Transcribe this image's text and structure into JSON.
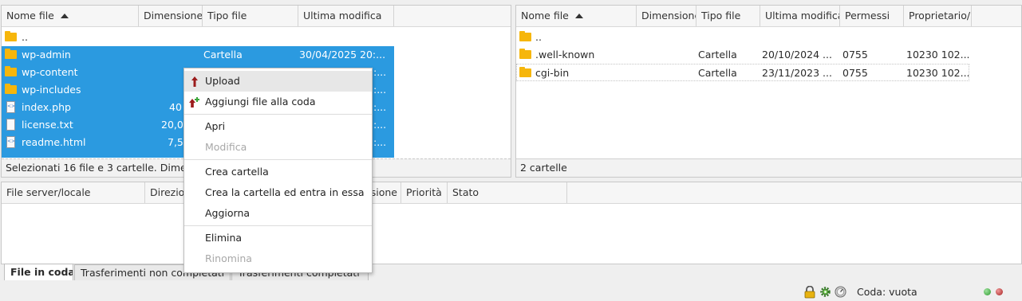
{
  "local_pane": {
    "columns": [
      "Nome file",
      "Dimensione",
      "Tipo file",
      "Ultima modifica"
    ],
    "rows": [
      {
        "name": "..",
        "size": "",
        "type": "",
        "modified": "",
        "icon": "folder-icon",
        "selected": false
      },
      {
        "name": "wp-admin",
        "size": "",
        "type": "Cartella",
        "modified": "30/04/2025 20:...",
        "icon": "folder-icon",
        "selected": true
      },
      {
        "name": "wp-content",
        "size": "",
        "type": "",
        "modified": ":...",
        "icon": "folder-icon",
        "selected": true
      },
      {
        "name": "wp-includes",
        "size": "",
        "type": "",
        "modified": ":...",
        "icon": "folder-icon",
        "selected": true
      },
      {
        "name": "index.php",
        "size": "40",
        "type": "",
        "modified": ":...",
        "icon": "file-code-icon",
        "selected": true
      },
      {
        "name": "license.txt",
        "size": "20,0",
        "type": "",
        "modified": ":...",
        "icon": "file-icon",
        "selected": true
      },
      {
        "name": "readme.html",
        "size": "7,5",
        "type": "",
        "modified": ":...",
        "icon": "file-code-icon",
        "selected": true
      }
    ],
    "status": "Selezionati 16 file e 3 cartelle. Dimensi"
  },
  "remote_pane": {
    "columns": [
      "Nome file",
      "Dimensione",
      "Tipo file",
      "Ultima modifica",
      "Permessi",
      "Proprietario/"
    ],
    "rows": [
      {
        "name": "..",
        "type": "",
        "modified": "",
        "perms": "",
        "owner": ""
      },
      {
        "name": ".well-known",
        "type": "Cartella",
        "modified": "20/10/2024 ...",
        "perms": "0755",
        "owner": "10230 102..."
      },
      {
        "name": "cgi-bin",
        "type": "Cartella",
        "modified": "23/11/2023 ...",
        "perms": "0755",
        "owner": "10230 102..."
      }
    ],
    "status": "2 cartelle"
  },
  "queue": {
    "columns": [
      "File server/locale",
      "Direzio",
      "sione",
      "Priorità",
      "Stato"
    ]
  },
  "context_menu": {
    "items": [
      {
        "label": "Upload",
        "icon": "upload-arrow-icon"
      },
      {
        "label": "Aggiungi file alla coda",
        "icon": "add-to-queue-icon"
      },
      {
        "label": "Apri"
      },
      {
        "label": "Modifica",
        "disabled": true
      },
      {
        "label": "Crea cartella"
      },
      {
        "label": "Crea la cartella ed entra in essa"
      },
      {
        "label": "Aggiorna"
      },
      {
        "label": "Elimina"
      },
      {
        "label": "Rinomina",
        "disabled": true
      }
    ]
  },
  "tabs": [
    "File in coda",
    "Trasferimenti non completati",
    "Trasferimenti completati"
  ],
  "status_bar": {
    "queue_label": "Coda: vuota",
    "icons": [
      "lock-icon",
      "gear-icon",
      "speed-limit-icon"
    ]
  },
  "colors": {
    "selection": "#2b9ae0",
    "folder": "#f6b60b",
    "led_green": "#3bb03b",
    "led_red": "#c0392b",
    "upload_arrow": "#9b1c1c"
  }
}
